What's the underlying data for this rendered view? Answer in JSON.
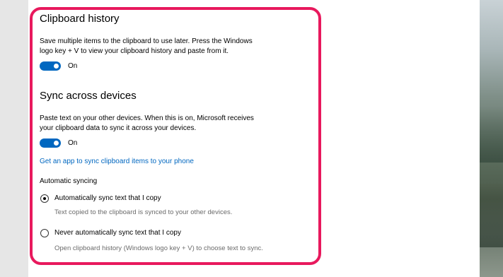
{
  "clipboard_history": {
    "title": "Clipboard history",
    "description": "Save multiple items to the clipboard to use later. Press the Windows logo key + V to view your clipboard history and paste from it.",
    "toggle_state": "On"
  },
  "sync": {
    "title": "Sync across devices",
    "description": "Paste text on your other devices. When this is on, Microsoft receives your clipboard data to sync it across your devices.",
    "toggle_state": "On",
    "link": "Get an app to sync clipboard items to your phone",
    "auto_sync_label": "Automatic syncing",
    "options": [
      {
        "label": "Automatically sync text that I copy",
        "help": "Text copied to the clipboard is synced to your other devices.",
        "selected": true
      },
      {
        "label": "Never automatically sync text that I copy",
        "help": "Open clipboard history (Windows logo key + V) to choose text to sync.",
        "selected": false
      }
    ]
  },
  "colors": {
    "accent": "#0067c0",
    "highlight_border": "#e8195d"
  }
}
